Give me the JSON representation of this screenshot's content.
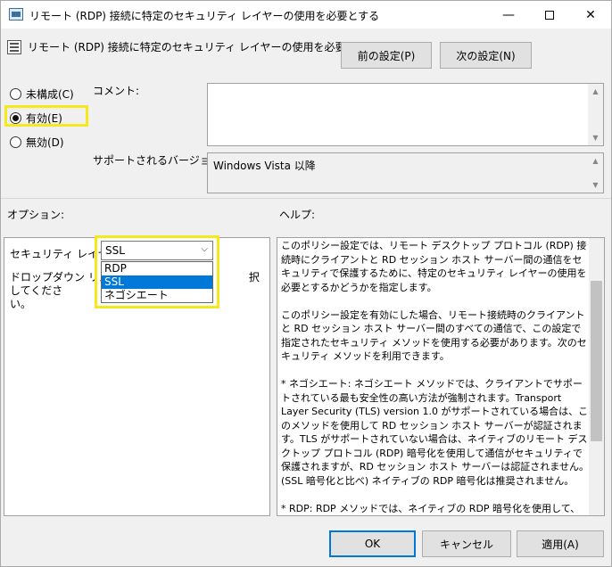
{
  "window": {
    "title": "リモート (RDP) 接続に特定のセキュリティ レイヤーの使用を必要とする",
    "minimize_glyph": "—",
    "close_glyph": "✕"
  },
  "header": {
    "policy_title": "リモート (RDP) 接続に特定のセキュリティ レイヤーの使用を必要とする",
    "prev_label": "前の設定(P)",
    "next_label": "次の設定(N)"
  },
  "state": {
    "options": [
      {
        "label": "未構成(C)",
        "selected": false
      },
      {
        "label": "有効(E)",
        "selected": true
      },
      {
        "label": "無効(D)",
        "selected": false
      }
    ]
  },
  "comment": {
    "label": "コメント:",
    "value": ""
  },
  "supported": {
    "label": "サポートされるバージョン:",
    "value": "Windows Vista 以降"
  },
  "options_section": {
    "label": "オプション:",
    "security_layer_label": "セキュリティ レイヤー",
    "selected_value": "SSL",
    "dropdown_items": [
      "RDP",
      "SSL",
      "ネゴシエート"
    ],
    "description_left": "ドロップダウン リストか",
    "description_right": "択してくださ",
    "description_end": "い。"
  },
  "help": {
    "label": "ヘルプ:",
    "paragraphs": [
      "このポリシー設定では、リモート デスクトップ プロトコル (RDP) 接続時にクライアントと RD セッション ホスト サーバー間の通信をセキュリティで保護するために、特定のセキュリティ レイヤーの使用を必要とするかどうかを指定します。",
      "このポリシー設定を有効にした場合、リモート接続時のクライアントと RD セッション ホスト サーバー間のすべての通信で、この設定で指定されたセキュリティ メソッドを使用する必要があります。次のセキュリティ メソッドを利用できます。",
      "* ネゴシエート: ネゴシエート メソッドでは、クライアントでサポートされている最も安全性の高い方法が強制されます。Transport Layer Security (TLS) version 1.0 がサポートされている場合は、このメソッドを使用して RD セッション ホスト サーバーが認証されます。TLS がサポートされていない場合は、ネイティブのリモート デスクトップ プロトコル (RDP) 暗号化を使用して通信がセキュリティで保護されますが、RD セッション ホスト サーバーは認証されません。(SSL 暗号化と比べ) ネイティブの RDP 暗号化は推奨されません。",
      "* RDP: RDP メソッドでは、ネイティブの RDP 暗号化を使用して、クライアントと RD セッション ホスト サーバー間の通信がセキュリティで保護されま"
    ]
  },
  "footer": {
    "ok_label": "OK",
    "cancel_label": "キャンセル",
    "apply_label": "適用(A)"
  },
  "colors": {
    "highlight": "#f5e81c",
    "selection": "#0078d7"
  }
}
